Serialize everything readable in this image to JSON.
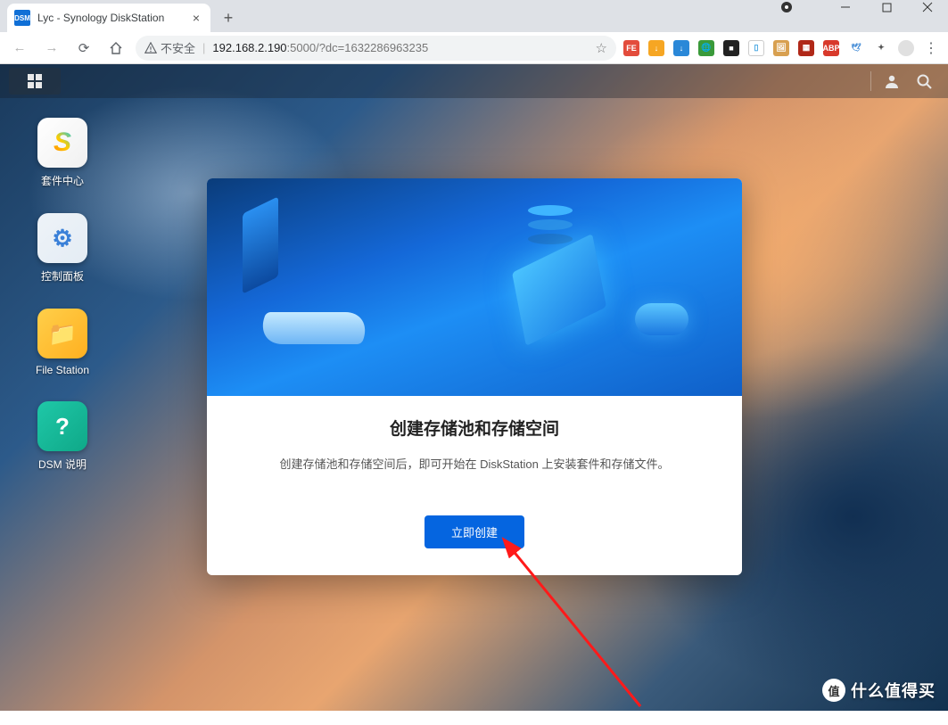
{
  "window": {
    "tab_title": "Lyc - Synology DiskStation",
    "favicon_text": "DSM"
  },
  "addressbar": {
    "insecure_label": "不安全",
    "url_host": "192.168.2.190",
    "url_port_path": ":5000/?dc=1632286963235"
  },
  "extensions": [
    {
      "name": "fe-ext",
      "bg": "#e34c3c",
      "text": "FE"
    },
    {
      "name": "dl1-ext",
      "bg": "#f6a623",
      "text": "↓"
    },
    {
      "name": "dl2-ext",
      "bg": "#2a88d8",
      "text": "↓"
    },
    {
      "name": "globe-ext",
      "bg": "#3a9a3a",
      "text": "🌐"
    },
    {
      "name": "box-ext",
      "bg": "#222",
      "text": "■"
    },
    {
      "name": "card-ext",
      "bg": "#ffffff",
      "text": "▯",
      "fg": "#3aa0e0",
      "border": "1"
    },
    {
      "name": "pic-ext",
      "bg": "#d8a050",
      "text": "🖼"
    },
    {
      "name": "red-ext",
      "bg": "#b02818",
      "text": "▦"
    },
    {
      "name": "abp-ext",
      "bg": "#d8392b",
      "text": "ABP"
    },
    {
      "name": "bird-ext",
      "bg": "transparent",
      "text": "🕊",
      "fg": "#4a90d8"
    },
    {
      "name": "puzzle-ext",
      "bg": "transparent",
      "text": "✦",
      "fg": "#555"
    },
    {
      "name": "profile-ext",
      "bg": "#e0e0e0",
      "text": "",
      "round": "1"
    }
  ],
  "desktop_icons": [
    {
      "name": "package-center",
      "label": "套件中心",
      "bg": "linear-gradient(135deg,#fff,#f0f0f0)",
      "glyph": "S",
      "glyph_color": "linear-gradient(45deg,#ff7a00,#ffcc00,#00c8ff)"
    },
    {
      "name": "control-panel",
      "label": "控制面板",
      "bg": "linear-gradient(135deg,#eef3f8,#e4ecf4)",
      "glyph": "⚙",
      "glyph_color": "#3a80d8"
    },
    {
      "name": "file-station",
      "label": "File Station",
      "bg": "linear-gradient(135deg,#ffcf4a,#ffb020)",
      "glyph": "📁",
      "glyph_color": "#fff"
    },
    {
      "name": "dsm-help",
      "label": "DSM 说明",
      "bg": "linear-gradient(135deg,#1fc8a8,#0fa888)",
      "glyph": "?",
      "glyph_color": "#fff"
    }
  ],
  "modal": {
    "title": "创建存储池和存储空间",
    "description": "创建存储池和存储空间后，即可开始在 DiskStation 上安装套件和存储文件。",
    "button": "立即创建"
  },
  "watermark": {
    "badge": "值",
    "text": "什么值得买"
  }
}
